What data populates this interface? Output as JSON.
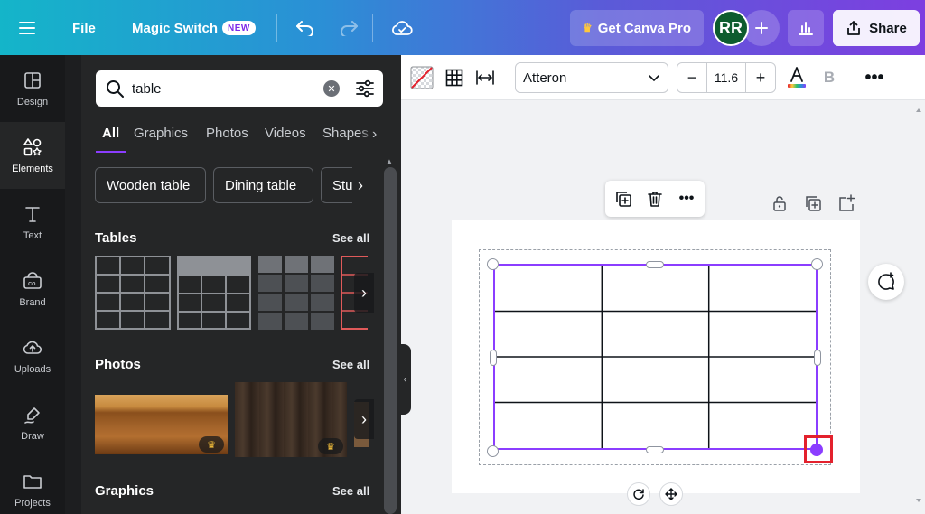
{
  "topbar": {
    "file_label": "File",
    "magic_switch_label": "Magic Switch",
    "new_badge": "NEW",
    "pro_label": "Get Canva Pro",
    "avatar_initials": "RR",
    "share_label": "Share"
  },
  "rail": {
    "items": [
      {
        "label": "Design",
        "icon": "layout-icon"
      },
      {
        "label": "Elements",
        "icon": "shapes-icon"
      },
      {
        "label": "Text",
        "icon": "text-icon"
      },
      {
        "label": "Brand",
        "icon": "brand-icon"
      },
      {
        "label": "Uploads",
        "icon": "cloud-upload-icon"
      },
      {
        "label": "Draw",
        "icon": "draw-icon"
      },
      {
        "label": "Projects",
        "icon": "folder-icon"
      }
    ]
  },
  "panel": {
    "search_value": "table",
    "tabs": [
      "All",
      "Graphics",
      "Photos",
      "Videos",
      "Shapes"
    ],
    "chips": [
      "Wooden table",
      "Dining table",
      "Studio"
    ],
    "sections": {
      "tables": "Tables",
      "photos": "Photos",
      "graphics": "Graphics",
      "see_all": "See all"
    }
  },
  "toolbar": {
    "font_name": "Atteron",
    "font_size": "11.6",
    "bold_label": "B"
  },
  "colors": {
    "accent": "#8b3dff",
    "highlight": "#e3212d",
    "panel_bg": "#252627",
    "rail_bg": "#18191b"
  }
}
